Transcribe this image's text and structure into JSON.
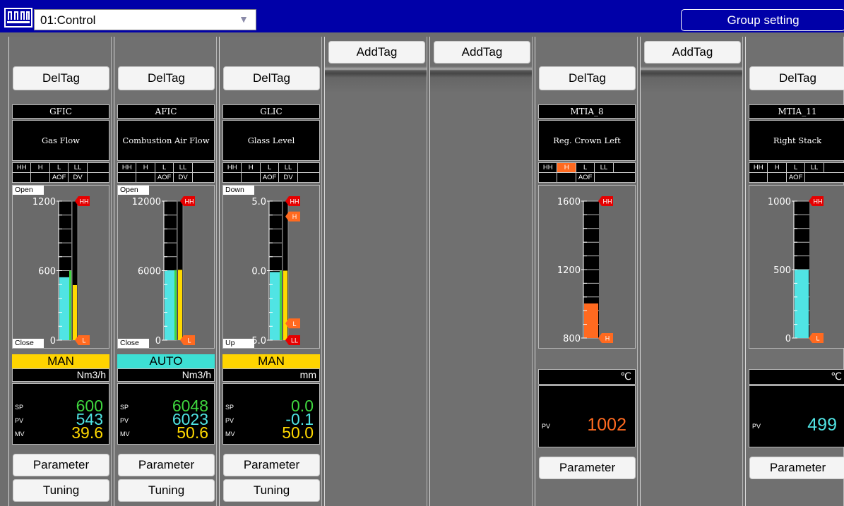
{
  "header": {
    "group_value": "01:Control",
    "group_setting_label": "Group setting"
  },
  "buttons": {
    "add": "AddTag",
    "del": "DelTag",
    "parameter": "Parameter",
    "tuning": "Tuning"
  },
  "alarm_labels": {
    "hh": "HH",
    "h": "H",
    "l": "L",
    "ll": "LL",
    "aof": "AOF",
    "dv": "DV"
  },
  "marker_labels": {
    "hh": "HH",
    "h": "H",
    "l": "L",
    "ll": "LL"
  },
  "colors": {
    "title_bar": "#0000a8",
    "sp_green": "#3fd73f",
    "pv_cyan": "#50e4e4",
    "mv_yellow": "#ffd900",
    "alarm_orange": "#ff6a20",
    "alarm_red": "#e60000",
    "mode_man": "#ffd400",
    "mode_auto": "#3de0d4"
  },
  "panels": [
    {
      "kind": "controller",
      "tag": "GFIC",
      "desc": "Gas Flow",
      "top_label": "Open",
      "bottom_label": "Close",
      "scale": [
        "1200",
        "600",
        "0"
      ],
      "range": [
        0,
        1200
      ],
      "pv": 543,
      "sp": 600,
      "mv": 39.6,
      "markers": [
        {
          "type": "hh",
          "value": 1200
        },
        {
          "type": "l",
          "value": 0
        }
      ],
      "mode": "MAN",
      "unit": "Nm3/h",
      "sp_text": "600",
      "pv_text": "543",
      "mv_text": "39.6",
      "row_labels": [
        "SP",
        "PV",
        "MV"
      ]
    },
    {
      "kind": "controller",
      "tag": "AFIC",
      "desc": "Combustion Air Flow",
      "top_label": "Open",
      "bottom_label": "Close",
      "scale": [
        "12000",
        "6000",
        "0"
      ],
      "range": [
        0,
        12000
      ],
      "pv": 6023,
      "sp": 6048,
      "mv": 50.6,
      "markers": [
        {
          "type": "hh",
          "value": 12000
        },
        {
          "type": "l",
          "value": 0
        }
      ],
      "mode": "AUTO",
      "unit": "Nm3/h",
      "sp_text": "6048",
      "pv_text": "6023",
      "mv_text": "50.6",
      "row_labels": [
        "SP",
        "PV",
        "MV"
      ]
    },
    {
      "kind": "controller",
      "tag": "GLIC",
      "desc": "Glass Level",
      "top_label": "Down",
      "bottom_label": "Up",
      "scale": [
        "5.0",
        "0.0",
        "-5.0"
      ],
      "range": [
        -5,
        5
      ],
      "pv": -0.1,
      "sp": 0.0,
      "mv": 50.0,
      "markers": [
        {
          "type": "hh",
          "value": 5.0
        },
        {
          "type": "h",
          "value": 4.0
        },
        {
          "type": "l",
          "value": -4.0
        },
        {
          "type": "ll",
          "value": -5.0
        }
      ],
      "mode": "MAN",
      "unit": "mm",
      "sp_text": "0.0",
      "pv_text": "-0.1",
      "mv_text": "50.0",
      "row_labels": [
        "SP",
        "PV",
        "MV"
      ]
    },
    {
      "kind": "empty"
    },
    {
      "kind": "empty"
    },
    {
      "kind": "indicator",
      "tag": "MTIA_8",
      "desc": "Reg. Crown Left",
      "scale": [
        "1600",
        "1200",
        "800"
      ],
      "range": [
        800,
        1600
      ],
      "pv": 1002,
      "markers": [
        {
          "type": "hh",
          "value": 1600
        },
        {
          "type": "h",
          "value": 800
        }
      ],
      "h_active": true,
      "unit": "℃",
      "pv_text": "1002",
      "row_labels": [
        "PV"
      ]
    },
    {
      "kind": "empty"
    },
    {
      "kind": "indicator",
      "tag": "MTIA_11",
      "desc": "Right Stack",
      "scale": [
        "1000",
        "500",
        "0"
      ],
      "range": [
        0,
        1000
      ],
      "pv": 499,
      "markers": [
        {
          "type": "hh",
          "value": 1000
        },
        {
          "type": "l",
          "value": 0
        }
      ],
      "h_active": false,
      "unit": "℃",
      "pv_text": "499",
      "row_labels": [
        "PV"
      ]
    }
  ]
}
